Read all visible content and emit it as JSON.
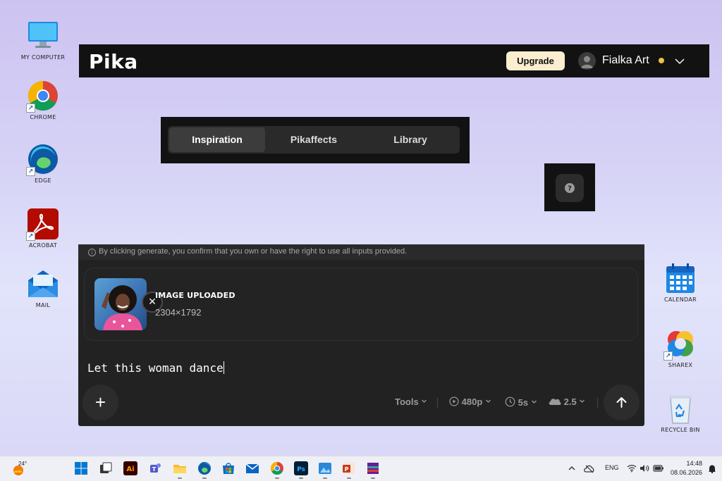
{
  "desktop": {
    "icons_left": [
      {
        "label": "MY COMPUTER",
        "icon": "monitor-icon"
      },
      {
        "label": "CHROME",
        "icon": "chrome-icon"
      },
      {
        "label": "EDGE",
        "icon": "edge-icon"
      },
      {
        "label": "ACROBAT",
        "icon": "acrobat-icon"
      },
      {
        "label": "MAIL",
        "icon": "mail-icon"
      }
    ],
    "icons_right": [
      {
        "label": "CALENDAR",
        "icon": "calendar-icon"
      },
      {
        "label": "SHAREX",
        "icon": "sharex-icon"
      },
      {
        "label": "RECYCLE BIN",
        "icon": "recycle-bin-icon"
      }
    ]
  },
  "header": {
    "logo": "Pika",
    "upgrade_label": "Upgrade",
    "user_name": "Fialka Art",
    "status_dot_color": "#f0c04b"
  },
  "tabs": [
    {
      "label": "Inspiration",
      "active": true
    },
    {
      "label": "Pikaffects",
      "active": false
    },
    {
      "label": "Library",
      "active": false
    }
  ],
  "help": {
    "icon": "question-icon"
  },
  "composer": {
    "notice": "By clicking generate, you confirm that you own or have the right to use all inputs provided.",
    "upload_title": "IMAGE UPLOADED",
    "upload_dims": "2304×1792",
    "prompt_text": "Let this woman dance",
    "tools_label": "Tools",
    "resolution": "480p",
    "duration": "5s",
    "model": "2.5"
  },
  "taskbar": {
    "weather_temp": "24°",
    "language": "ENG",
    "time": "14:48",
    "date": "08.06.2026"
  }
}
